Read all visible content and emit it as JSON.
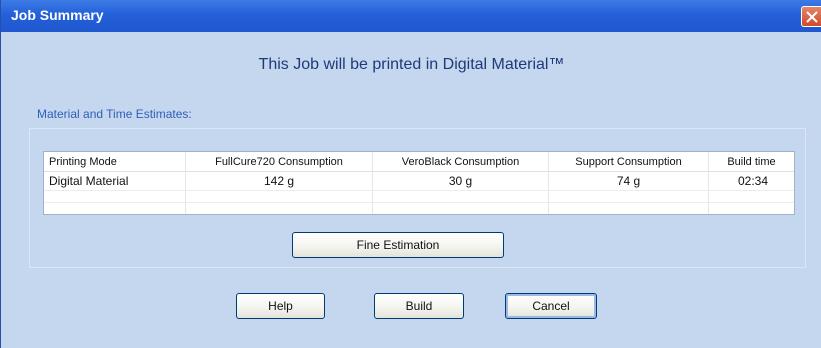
{
  "window": {
    "title": "Job Summary",
    "colors": {
      "titlebar": "#2460d8",
      "body": "#c5d7ef",
      "close": "#cf4a2a"
    }
  },
  "headline": "This Job will be printed in Digital Material™",
  "section_label": "Material and Time Estimates:",
  "table": {
    "columns": [
      "Printing Mode",
      "FullCure720 Consumption",
      "VeroBlack Consumption",
      "Support Consumption",
      "Build time"
    ],
    "rows": [
      [
        "Digital Material",
        "142 g",
        "30 g",
        "74 g",
        "02:34"
      ]
    ]
  },
  "buttons": {
    "fine_estimation": "Fine Estimation",
    "help": "Help",
    "build": "Build",
    "cancel": "Cancel"
  },
  "icons": {
    "close": "close-icon"
  }
}
